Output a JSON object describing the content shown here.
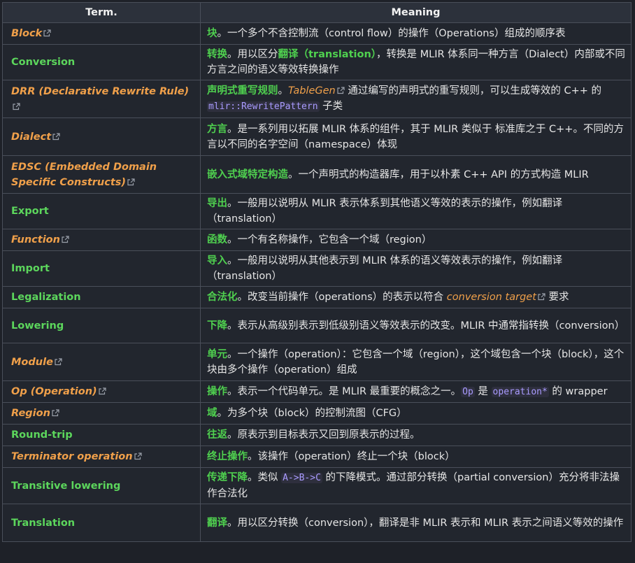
{
  "headers": {
    "term": "Term.",
    "meaning": "Meaning"
  },
  "rows": [
    {
      "term": "Block",
      "linked": true,
      "parts": [
        {
          "t": "hl",
          "v": "块"
        },
        {
          "t": "txt",
          "v": "。一个多个不含控制流（control flow）的操作（Operations）组成的顺序表"
        }
      ]
    },
    {
      "term": "Conversion",
      "linked": false,
      "parts": [
        {
          "t": "hl",
          "v": "转换"
        },
        {
          "t": "txt",
          "v": "。用以区分"
        },
        {
          "t": "hl",
          "v": "翻译（translation）"
        },
        {
          "t": "txt",
          "v": "，转换是 MLIR 体系同一种方言（Dialect）内部或不同方言之间的语义等效转换操作"
        }
      ]
    },
    {
      "term": "DRR (Declarative Rewrite Rule)",
      "linked": true,
      "parts": [
        {
          "t": "hl",
          "v": "声明式重写规则"
        },
        {
          "t": "txt",
          "v": "。"
        },
        {
          "t": "link",
          "v": "TableGen"
        },
        {
          "t": "txt",
          "v": " 通过编写的声明式的重写规则，可以生成等效的 C++ 的 "
        },
        {
          "t": "code",
          "v": "mlir::RewritePattern"
        },
        {
          "t": "txt",
          "v": " 子类"
        }
      ]
    },
    {
      "term": "Dialect",
      "linked": true,
      "parts": [
        {
          "t": "hl",
          "v": "方言"
        },
        {
          "t": "txt",
          "v": "。是一系列用以拓展 MLIR 体系的组件，其于 MLIR 类似于 标准库之于 C++。不同的方言以不同的名字空间（namespace）体现"
        }
      ]
    },
    {
      "term": "EDSC (Embedded Domain Specific Constructs)",
      "linked": true,
      "parts": [
        {
          "t": "hl",
          "v": "嵌入式域特定构造"
        },
        {
          "t": "txt",
          "v": "。一个声明式的构造器库，用于以朴素 C++ API 的方式构造 MLIR"
        }
      ]
    },
    {
      "term": "Export",
      "linked": false,
      "parts": [
        {
          "t": "hl",
          "v": "导出"
        },
        {
          "t": "txt",
          "v": "。一般用以说明从 MLIR 表示体系到其他语义等效的表示的操作，例如翻译（translation）"
        }
      ]
    },
    {
      "term": "Function",
      "linked": true,
      "parts": [
        {
          "t": "hl",
          "v": "函数"
        },
        {
          "t": "txt",
          "v": "。一个有名称操作，它包含一个域（region）"
        }
      ]
    },
    {
      "term": "Import",
      "linked": false,
      "parts": [
        {
          "t": "hl",
          "v": "导入"
        },
        {
          "t": "txt",
          "v": "。一般用以说明从其他表示到 MLIR 体系的语义等效表示的操作，例如翻译（translation）"
        }
      ]
    },
    {
      "term": "Legalization",
      "linked": false,
      "parts": [
        {
          "t": "hl",
          "v": "合法化"
        },
        {
          "t": "txt",
          "v": "。改变当前操作（operations）的表示以符合 "
        },
        {
          "t": "link",
          "v": "conversion target"
        },
        {
          "t": "txt",
          "v": " 要求"
        }
      ]
    },
    {
      "term": "Lowering",
      "linked": false,
      "parts": [
        {
          "t": "hl",
          "v": "下降"
        },
        {
          "t": "txt",
          "v": "。表示从高级别表示到低级别语义等效表示的改变。MLIR 中通常指转换（conversion）"
        }
      ]
    },
    {
      "term": "Module",
      "linked": true,
      "parts": [
        {
          "t": "hl",
          "v": "单元"
        },
        {
          "t": "txt",
          "v": "。一个操作（operation）：它包含一个域（region），这个域包含一个块（block），这个块由多个操作（operation）组成"
        }
      ]
    },
    {
      "term": "Op (Operation)",
      "linked": true,
      "parts": [
        {
          "t": "hl",
          "v": "操作"
        },
        {
          "t": "txt",
          "v": "。表示一个代码单元。是 MLIR 最重要的概念之一。"
        },
        {
          "t": "code",
          "v": "Op"
        },
        {
          "t": "txt",
          "v": " 是 "
        },
        {
          "t": "code",
          "v": "operation*"
        },
        {
          "t": "txt",
          "v": " 的 wrapper"
        }
      ]
    },
    {
      "term": "Region",
      "linked": true,
      "parts": [
        {
          "t": "hl",
          "v": "域"
        },
        {
          "t": "txt",
          "v": "。为多个块（block）的控制流图（CFG）"
        }
      ]
    },
    {
      "term": "Round-trip",
      "linked": false,
      "parts": [
        {
          "t": "hl",
          "v": "往返"
        },
        {
          "t": "txt",
          "v": "。原表示到目标表示又回到原表示的过程。"
        }
      ]
    },
    {
      "term": "Terminator operation",
      "linked": true,
      "parts": [
        {
          "t": "hl",
          "v": "终止操作"
        },
        {
          "t": "txt",
          "v": "。该操作（operation）终止一个块（block）"
        }
      ]
    },
    {
      "term": "Transitive lowering",
      "linked": false,
      "parts": [
        {
          "t": "hl",
          "v": "传递下降"
        },
        {
          "t": "txt",
          "v": "。类似 "
        },
        {
          "t": "code",
          "v": "A->B->C"
        },
        {
          "t": "txt",
          "v": " 的下降模式。通过部分转换（partial conversion）充分将非法操作合法化"
        }
      ]
    },
    {
      "term": "Translation",
      "linked": false,
      "parts": [
        {
          "t": "hl",
          "v": "翻译"
        },
        {
          "t": "txt",
          "v": "。用以区分转换（conversion），翻译是非 MLIR 表示和 MLIR 表示之间语义等效的操作"
        }
      ]
    }
  ],
  "icons": {
    "external": "external-link-icon"
  },
  "colors": {
    "link": "#f0a04a",
    "highlight": "#4fd04f",
    "code": "#a99bff",
    "background": "#22262e"
  }
}
